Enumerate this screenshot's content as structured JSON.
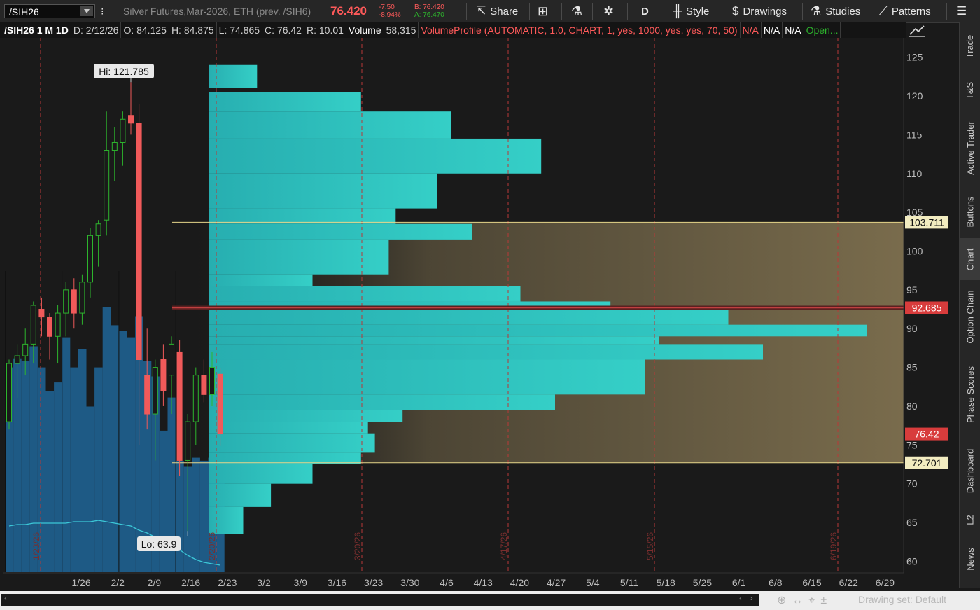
{
  "toolbar": {
    "symbol": "/SIH26",
    "description": "Silver Futures,Mar-2026, ETH (prev. /SIH6)",
    "last_price": "76.420",
    "net_change": "-7.50",
    "pct_change": "-8.94%",
    "bid": "B: 76.420",
    "ask": "A: 76.470",
    "share_label": "Share",
    "period_label": "D",
    "style_label": "Style",
    "drawings_label": "Drawings",
    "studies_label": "Studies",
    "patterns_label": "Patterns"
  },
  "info_bar": {
    "title": "/SIH26 1 M 1D",
    "date": "D: 2/12/26",
    "open": "O: 84.125",
    "high": "H: 84.875",
    "low": "L: 74.865",
    "close": "C: 76.42",
    "range": "R: 10.01",
    "volume_label": "Volume",
    "volume_value": "58,315",
    "study": "VolumeProfile (AUTOMATIC, 1.0, CHART, 1, yes, 1000, yes, yes, 70, 50)",
    "na1": "N/A",
    "na2": "N/A",
    "na3": "N/A",
    "open_label": "Open..."
  },
  "right_tabs": [
    "Trade",
    "T&S",
    "Active Trader",
    "Buttons",
    "Chart",
    "Option Chain",
    "Phase Scores",
    "Dashboard",
    "L2",
    "News"
  ],
  "bottom": {
    "drawing_set": "Drawing set: Default"
  },
  "colors": {
    "up": "#2db52d",
    "down": "#f05a5a",
    "profile": "#2ec4c0",
    "volume": "#1e5a85",
    "value_area": "#8a7a55",
    "poc": "#c04040"
  },
  "chart_data": {
    "type": "candlestick",
    "y_range": [
      58.5,
      127.5
    ],
    "y_ticks": [
      60,
      65,
      70,
      75,
      80,
      85,
      90,
      95,
      100,
      105,
      110,
      115,
      120,
      125
    ],
    "x_labels": [
      "1/26",
      "2/2",
      "2/9",
      "2/16",
      "2/23",
      "3/2",
      "3/9",
      "3/16",
      "3/23",
      "3/30",
      "4/6",
      "4/13",
      "4/20",
      "4/27",
      "5/4",
      "5/11",
      "5/18",
      "5/25",
      "6/1",
      "6/8",
      "6/15",
      "6/22",
      "6/29"
    ],
    "expiry_labels": [
      "1/23/26",
      "2/20/26",
      "3/20/26",
      "4/17/26",
      "5/15/26",
      "6/19/26"
    ],
    "candles": [
      [
        78.0,
        86.0,
        77.0,
        85.5
      ],
      [
        85.5,
        88.0,
        81.0,
        86.5
      ],
      [
        86.5,
        90.0,
        84.0,
        88.0
      ],
      [
        88.0,
        93.5,
        85.5,
        93.0
      ],
      [
        92.5,
        94.0,
        89.0,
        91.5
      ],
      [
        91.5,
        92.0,
        86.0,
        89.0
      ],
      [
        89.0,
        93.0,
        85.5,
        92.0
      ],
      [
        92.0,
        96.0,
        89.0,
        95.0
      ],
      [
        95.0,
        96.5,
        90.0,
        92.0
      ],
      [
        92.0,
        97.0,
        90.5,
        96.0
      ],
      [
        96.0,
        103.0,
        94.0,
        102.0
      ],
      [
        102.0,
        104.0,
        98.0,
        103.5
      ],
      [
        104.0,
        118.0,
        102.0,
        113.0
      ],
      [
        113.0,
        116.0,
        109.0,
        114.0
      ],
      [
        114.0,
        118.0,
        111.0,
        117.0
      ],
      [
        117.5,
        121.785,
        115.0,
        116.5
      ],
      [
        116.5,
        119.0,
        75.0,
        86.0
      ],
      [
        84.0,
        90.0,
        77.0,
        79.0
      ],
      [
        79.0,
        86.0,
        73.0,
        85.0
      ],
      [
        86.0,
        88.0,
        80.0,
        82.0
      ],
      [
        84.0,
        89.0,
        79.0,
        88.0
      ],
      [
        87.0,
        88.5,
        71.0,
        73.0
      ],
      [
        73.0,
        79.0,
        63.9,
        78.0
      ],
      [
        78.0,
        85.0,
        75.0,
        84.0
      ],
      [
        84.0,
        86.0,
        80.5,
        81.5
      ],
      [
        81.5,
        87.0,
        80.0,
        85.0
      ],
      [
        84.125,
        84.875,
        74.865,
        76.42
      ]
    ],
    "volume_fraction": [
      0.68,
      0.71,
      0.7,
      0.75,
      0.68,
      0.6,
      0.63,
      0.78,
      0.68,
      0.74,
      0.55,
      0.68,
      0.88,
      0.82,
      0.8,
      0.78,
      0.85,
      0.7,
      0.65,
      0.47,
      0.58,
      0.37,
      0.35,
      0.38,
      0.37,
      0.38,
      0.37
    ],
    "avg_volume_fraction": [
      0.33,
      0.34,
      0.34,
      0.35,
      0.35,
      0.35,
      0.35,
      0.35,
      0.36,
      0.36,
      0.36,
      0.37,
      0.36,
      0.35,
      0.34,
      0.33,
      0.3,
      0.28,
      0.25,
      0.22,
      0.19,
      0.16,
      0.12,
      0.09,
      0.07,
      0.06,
      0.05
    ],
    "volume_profile": [
      [
        121.0,
        124.0,
        0.07
      ],
      [
        118.0,
        120.5,
        0.22
      ],
      [
        114.5,
        118.0,
        0.35
      ],
      [
        110.0,
        114.5,
        0.48
      ],
      [
        105.5,
        110.0,
        0.33
      ],
      [
        103.5,
        105.5,
        0.27
      ],
      [
        101.5,
        103.5,
        0.38
      ],
      [
        97.0,
        101.5,
        0.26
      ],
      [
        95.5,
        97.0,
        0.15
      ],
      [
        93.5,
        95.5,
        0.45
      ],
      [
        92.5,
        93.5,
        0.58
      ],
      [
        90.5,
        92.5,
        0.75
      ],
      [
        89.0,
        90.5,
        0.95
      ],
      [
        88.0,
        89.0,
        0.65
      ],
      [
        86.0,
        88.0,
        0.8
      ],
      [
        84.0,
        86.0,
        0.63
      ],
      [
        81.5,
        84.0,
        0.63
      ],
      [
        79.5,
        81.5,
        0.5
      ],
      [
        78.0,
        79.5,
        0.28
      ],
      [
        76.5,
        78.0,
        0.23
      ],
      [
        74.0,
        76.5,
        0.24
      ],
      [
        72.5,
        74.0,
        0.22
      ],
      [
        70.0,
        72.5,
        0.15
      ],
      [
        67.0,
        70.0,
        0.09
      ],
      [
        63.5,
        67.0,
        0.05
      ]
    ],
    "value_area_high": 103.711,
    "value_area_low": 72.701,
    "poc": 92.685,
    "last": 76.42,
    "hi_label": "Hi: 121.785",
    "lo_label": "Lo: 63.9",
    "price_labels": [
      "103.711",
      "92.685",
      "76.42",
      "72.701"
    ]
  }
}
